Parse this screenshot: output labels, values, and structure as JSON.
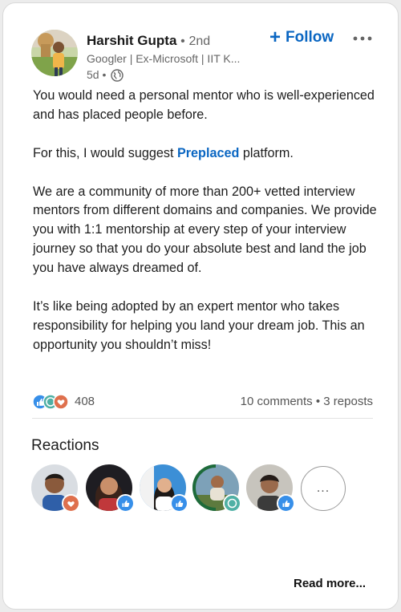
{
  "author": {
    "name": "Harshit Gupta",
    "degree_sep": "•",
    "degree": "2nd",
    "headline": "Googler | Ex-Microsoft | IIT K...",
    "time": "5d •"
  },
  "actions": {
    "follow_icon": "+",
    "follow_label": "Follow",
    "more_icon": "more-horizontal-icon"
  },
  "post": {
    "p1": "You would need a personal mentor who is well-experienced and has placed people before.",
    "p2_before": "For this, I would suggest ",
    "p2_link": "Preplaced",
    "p2_after": " platform.",
    "p3": "We are a community of more than 200+ vetted interview mentors from different domains and companies. We provide you with 1:1 mentorship at every step of your interview journey so that you do your absolute best and land the job you have always dreamed of.",
    "p4": "It’s like being adopted by an expert mentor who takes responsibility for helping you land your dream job. This an opportunity you shouldn’t miss!"
  },
  "stats": {
    "reaction_count": "408",
    "comments": "10 comments",
    "separator": "•",
    "reposts": "3 reposts"
  },
  "reactions": {
    "title": "Reactions",
    "more_label": "..."
  },
  "footer": {
    "read_more": "Read more..."
  },
  "colors": {
    "link_blue": "#0a66c2",
    "like_blue": "#378fe9",
    "love_red": "#df704d"
  }
}
